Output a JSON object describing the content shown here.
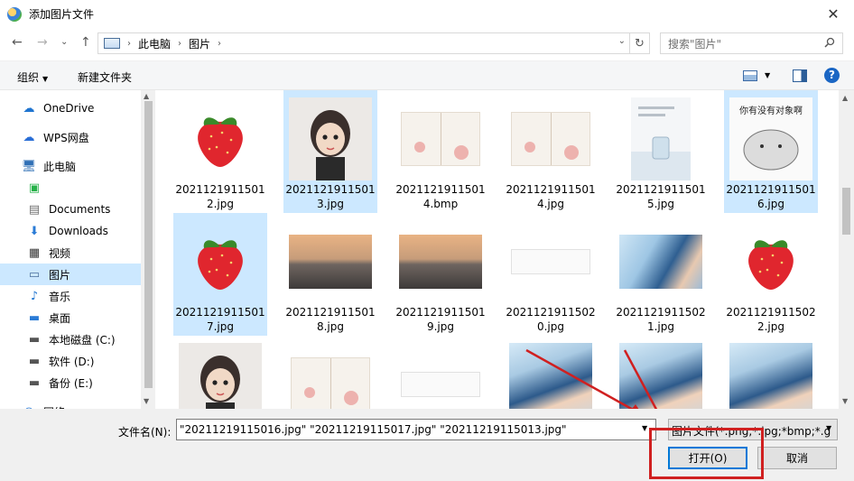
{
  "window": {
    "title": "添加图片文件",
    "close_glyph": "✕"
  },
  "address": {
    "back_glyph": "←",
    "forward_glyph": "→",
    "recent_glyph": "⌄",
    "up_glyph": "↑",
    "crumbs": [
      "此电脑",
      "图片"
    ],
    "refresh_glyph": "↻",
    "search_placeholder": "搜索\"图片\""
  },
  "toolbar": {
    "organize_label": "组织",
    "new_folder_label": "新建文件夹",
    "help_label": "?"
  },
  "sidebar": {
    "items": [
      {
        "label": "OneDrive",
        "icon": "cloud-icon",
        "glyph": "☁",
        "color": "#1e74d0"
      },
      {
        "label": "WPS网盘",
        "icon": "cloud-icon",
        "glyph": "☁",
        "color": "#2a6ed6"
      },
      {
        "label": "此电脑",
        "icon": "computer-icon",
        "glyph": "🖥",
        "color": "#2f6fb5"
      },
      {
        "label": "",
        "icon": "app-icon",
        "glyph": "▣",
        "color": "#27b24a"
      },
      {
        "label": "Documents",
        "icon": "document-icon",
        "glyph": "▤",
        "color": "#6f6f6f"
      },
      {
        "label": "Downloads",
        "icon": "download-icon",
        "glyph": "⬇",
        "color": "#2a7bd6"
      },
      {
        "label": "视频",
        "icon": "video-icon",
        "glyph": "▦",
        "color": "#333333"
      },
      {
        "label": "图片",
        "icon": "picture-icon",
        "glyph": "▭",
        "color": "#4a6f9a"
      },
      {
        "label": "音乐",
        "icon": "music-icon",
        "glyph": "♪",
        "color": "#1e74d0"
      },
      {
        "label": "桌面",
        "icon": "desktop-icon",
        "glyph": "▬",
        "color": "#2a7bd6"
      },
      {
        "label": "本地磁盘 (C:)",
        "icon": "drive-icon",
        "glyph": "▬",
        "color": "#555555"
      },
      {
        "label": "软件 (D:)",
        "icon": "drive-icon",
        "glyph": "▬",
        "color": "#555555"
      },
      {
        "label": "备份 (E:)",
        "icon": "drive-icon",
        "glyph": "▬",
        "color": "#555555"
      },
      {
        "label": "网络",
        "icon": "network-icon",
        "glyph": "◉",
        "color": "#2a7bd6"
      }
    ],
    "selected_index": 7
  },
  "files": [
    {
      "label": "20211219115012.jpg",
      "kind": "strawberry",
      "selected": false
    },
    {
      "label": "20211219115013.jpg",
      "kind": "girl",
      "selected": true
    },
    {
      "label": "20211219115014.bmp",
      "kind": "doc",
      "selected": false
    },
    {
      "label": "20211219115014.jpg",
      "kind": "doc",
      "selected": false
    },
    {
      "label": "20211219115015.jpg",
      "kind": "jar",
      "selected": false
    },
    {
      "label": "20211219115016.jpg",
      "kind": "cartoon",
      "selected": true
    },
    {
      "label": "20211219115017.jpg",
      "kind": "strawberry",
      "selected": true
    },
    {
      "label": "20211219115018.jpg",
      "kind": "sunset",
      "selected": false
    },
    {
      "label": "20211219115019.jpg",
      "kind": "sunset",
      "selected": false
    },
    {
      "label": "20211219115020.jpg",
      "kind": "textdoc",
      "selected": false
    },
    {
      "label": "20211219115021.jpg",
      "kind": "boy",
      "selected": false
    },
    {
      "label": "20211219115022.jpg",
      "kind": "strawberry",
      "selected": false
    },
    {
      "label": "",
      "kind": "girl",
      "selected": false
    },
    {
      "label": "",
      "kind": "doc",
      "selected": false
    },
    {
      "label": "",
      "kind": "textdoc",
      "selected": false
    },
    {
      "label": "",
      "kind": "boy2",
      "selected": false
    },
    {
      "label": "",
      "kind": "boy2",
      "selected": false
    },
    {
      "label": "",
      "kind": "boy2",
      "selected": false
    }
  ],
  "thumb_text": {
    "cartoon_caption": "你有没有对象啊"
  },
  "bottom": {
    "filename_label": "文件名(N):",
    "filename_value": "\"20211219115016.jpg\" \"20211219115017.jpg\" \"20211219115013.jpg\"",
    "filetype_value": "图片文件(*.png;*.jpg;*bmp;*.g",
    "open_label": "打开(O)",
    "cancel_label": "取消"
  },
  "colors": {
    "selection": "#cce8ff",
    "accent": "#0078d7",
    "annotation_red": "#d02020"
  }
}
